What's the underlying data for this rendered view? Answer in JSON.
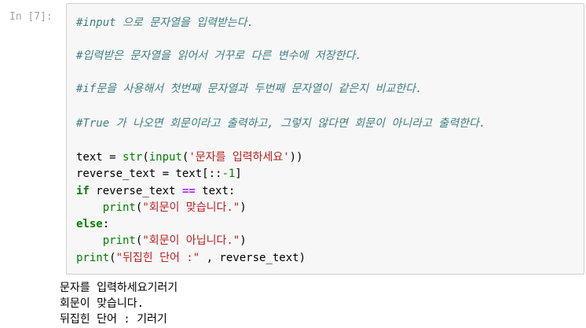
{
  "prompt_label": "In [7]:",
  "comments": [
    "#input 으로 문자열을 입력받는다.",
    "#입력받은 문자열을 읽어서 거꾸로 다른 변수에 저장한다.",
    "#if문을 사용해서 첫번째 문자열과 두번째 문자열이 같은지 비교한다.",
    "#True 가 나오면 회문이라고 출력하고, 그렇지 않다면 회문이 아니라고 출력한다."
  ],
  "code": {
    "l1": {
      "a": "text = ",
      "b": "str",
      "c": "(",
      "d": "input",
      "e": "(",
      "f": "'문자를 입력하세요'",
      "g": "))"
    },
    "l2": {
      "a": "reverse_text = text[::",
      "b": "-1",
      "c": "]"
    },
    "l3": {
      "a": "if",
      "b": " reverse_text ",
      "c": "==",
      "d": " text:"
    },
    "l4": {
      "a": "    ",
      "b": "print",
      "c": "(",
      "d": "\"회문이 맞습니다.\"",
      "e": ")"
    },
    "l5": {
      "a": "else",
      "b": ":"
    },
    "l6": {
      "a": "    ",
      "b": "print",
      "c": "(",
      "d": "\"회문이 아닙니다.\"",
      "e": ")"
    },
    "l7": {
      "a": "print",
      "b": "(",
      "c": "\"뒤집힌 단어 :\"",
      "d": " , reverse_text)"
    }
  },
  "output": [
    "문자를 입력하세요기러기",
    "회문이 맞습니다.",
    "뒤집힌 단어 : 기러기"
  ]
}
